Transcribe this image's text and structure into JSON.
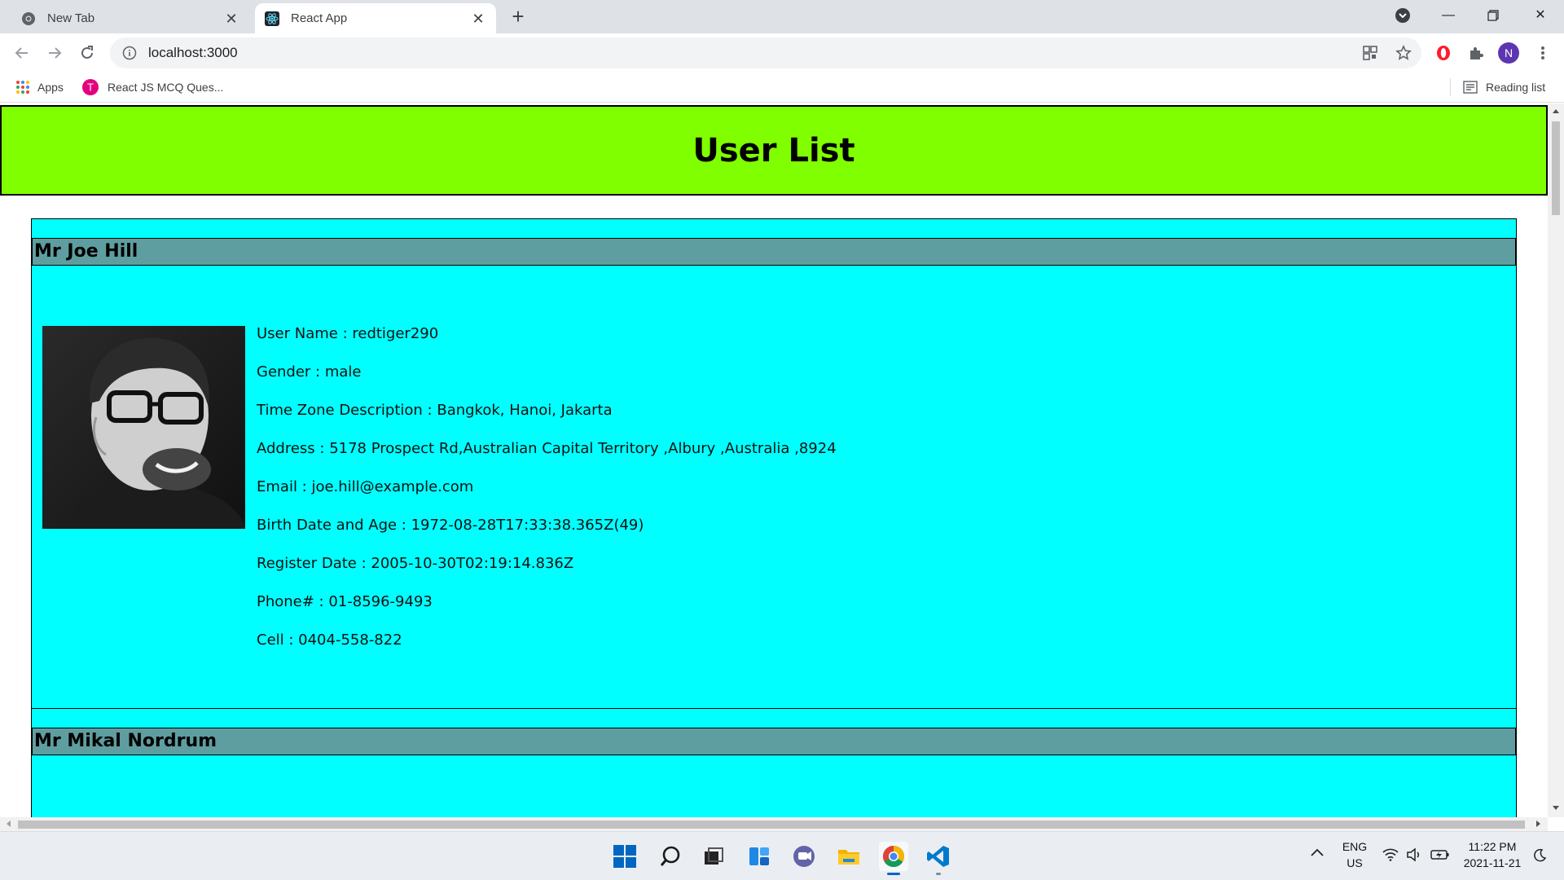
{
  "browser": {
    "tabs": [
      {
        "title": "New Tab",
        "active": false
      },
      {
        "title": "React App",
        "active": true
      }
    ],
    "url": "localhost:3000",
    "profile_initial": "N",
    "bookmarks": [
      {
        "label": "Apps"
      },
      {
        "label": "React JS MCQ Ques..."
      }
    ],
    "reading_list": "Reading list"
  },
  "page": {
    "title": "User List",
    "users": [
      {
        "name": "Mr Joe Hill",
        "username": "User Name : redtiger290",
        "gender": "Gender : male",
        "timezone": "Time Zone Description : Bangkok, Hanoi, Jakarta",
        "address": "Address : 5178 Prospect Rd,Australian Capital Territory ,Albury ,Australia ,8924",
        "email": "Email : joe.hill@example.com",
        "birth": "Birth Date and Age : 1972-08-28T17:33:38.365Z(49)",
        "registered": "Register Date : 2005-10-30T02:19:14.836Z",
        "phone": "Phone# : 01-8596-9493",
        "cell": "Cell : 0404-558-822"
      },
      {
        "name": "Mr Mikal Nordrum"
      }
    ]
  },
  "taskbar": {
    "language": "ENG",
    "region": "US",
    "time": "11:22 PM",
    "date": "2021-11-21"
  },
  "colors": {
    "header_bg": "#80ff00",
    "card_bg": "#00ffff",
    "card_title_bg": "#5f9ea0",
    "tab_strip": "#dee1e6"
  }
}
